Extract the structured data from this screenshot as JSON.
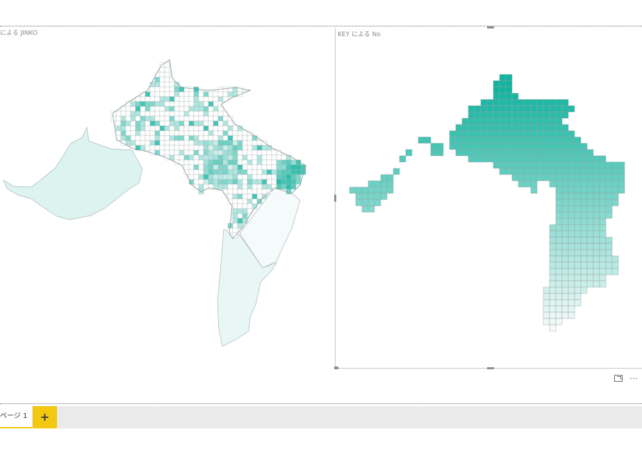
{
  "report": {
    "visuals": [
      {
        "id": "left",
        "title": "による JINKO"
      },
      {
        "id": "right",
        "title": "KEY による No"
      }
    ],
    "visual_tools": {
      "focus_icon": "focus-mode-icon",
      "more_icon": "more-options-icon",
      "more_glyph": "⋯"
    }
  },
  "pages": {
    "tabs": [
      {
        "label": "ページ 1",
        "active": true
      }
    ],
    "add_glyph": "+"
  },
  "colors": {
    "accent": "#f2c811",
    "teal_dark": "#10b5a0",
    "teal_light": "#d8f2ef",
    "outline": "#9e9e9e"
  }
}
